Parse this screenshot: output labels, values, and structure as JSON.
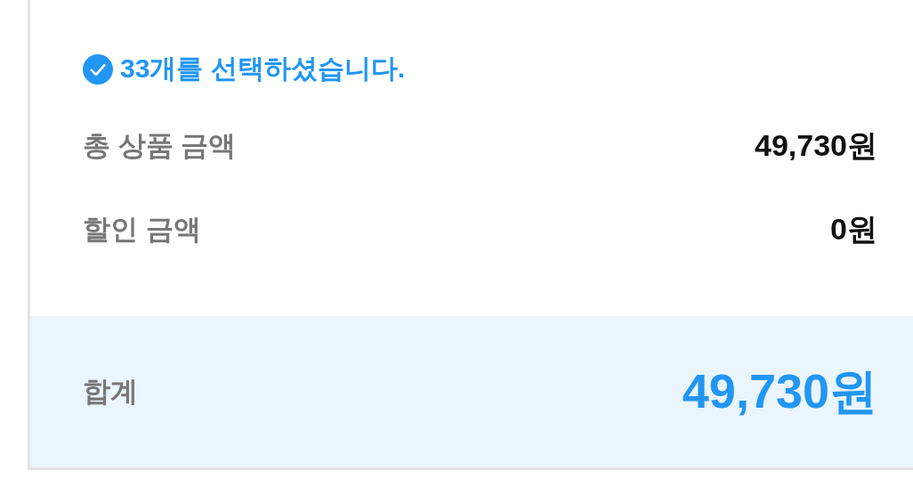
{
  "selection": {
    "checked": true,
    "text": "33개를 선택하셨습니다."
  },
  "rows": [
    {
      "label": "총 상품 금액",
      "value": "49,730원"
    },
    {
      "label": "할인 금액",
      "value": "0원"
    }
  ],
  "total": {
    "label": "합계",
    "value": "49,730원"
  }
}
